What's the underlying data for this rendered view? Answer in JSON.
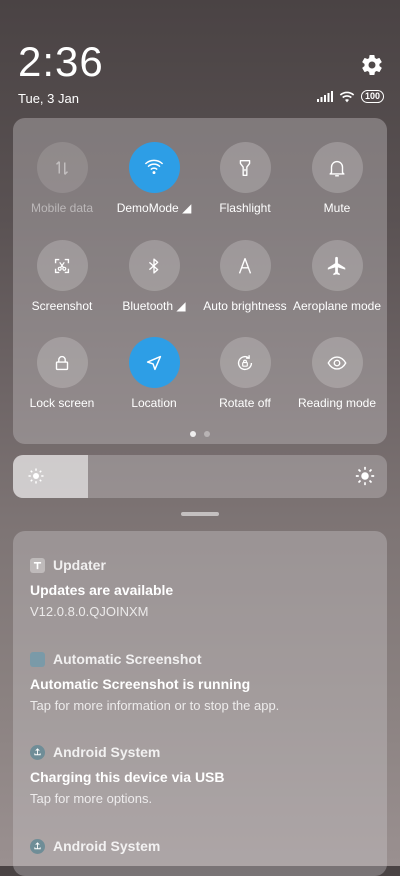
{
  "status_bar": {
    "time": "2:36",
    "date": "Tue, 3 Jan",
    "battery": "100"
  },
  "quick_settings": {
    "tiles": [
      {
        "label": "Mobile data",
        "icon": "mobile-data-icon",
        "state": "disabled"
      },
      {
        "label": "DemoMode ◢",
        "icon": "wifi-icon",
        "state": "on"
      },
      {
        "label": "Flashlight",
        "icon": "flashlight-icon",
        "state": "off"
      },
      {
        "label": "Mute",
        "icon": "bell-icon",
        "state": "off"
      },
      {
        "label": "Screenshot",
        "icon": "screenshot-icon",
        "state": "off"
      },
      {
        "label": "Bluetooth ◢",
        "icon": "bluetooth-icon",
        "state": "off"
      },
      {
        "label": "Auto brightness",
        "icon": "auto-brightness-icon",
        "state": "off"
      },
      {
        "label": "Aeroplane mode",
        "icon": "airplane-icon",
        "state": "off"
      },
      {
        "label": "Lock screen",
        "icon": "lock-icon",
        "state": "off"
      },
      {
        "label": "Location",
        "icon": "location-icon",
        "state": "on"
      },
      {
        "label": "Rotate off",
        "icon": "rotate-icon",
        "state": "off"
      },
      {
        "label": "Reading mode",
        "icon": "eye-icon",
        "state": "off"
      }
    ],
    "page_count": 2,
    "active_page": 1
  },
  "brightness": {
    "level_fraction": 0.2
  },
  "notifications": [
    {
      "app": "Updater",
      "title": "Updates are available",
      "body": "V12.0.8.0.QJOINXM"
    },
    {
      "app": "Automatic Screenshot",
      "title": "Automatic Screenshot is running",
      "body": "Tap for more information or to stop the app."
    },
    {
      "app": "Android System",
      "title": "Charging this device via USB",
      "body": "Tap for more options."
    },
    {
      "app": "Android System",
      "title": "",
      "body": ""
    }
  ],
  "colors": {
    "accent_on": "#2d9ee6"
  }
}
